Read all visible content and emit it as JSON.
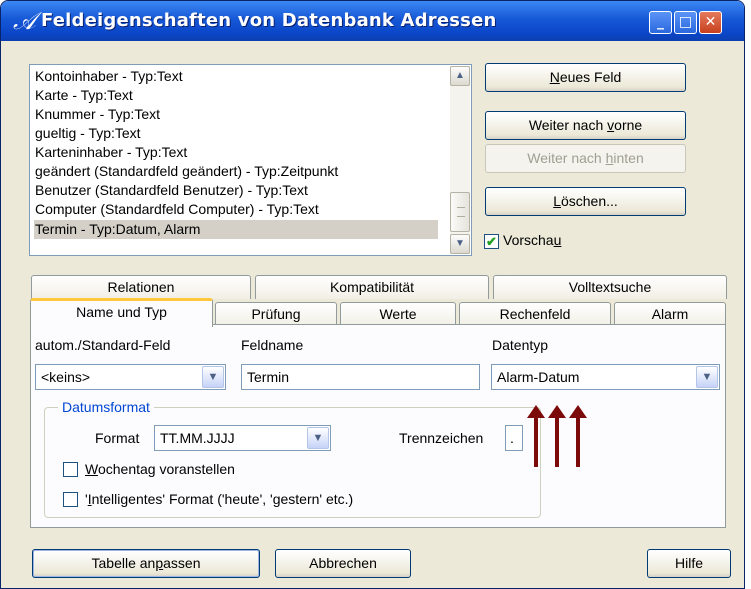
{
  "window": {
    "title": "Feldeigenschaften von Datenbank Adressen",
    "title_icon": "script-a-icon",
    "controls": [
      "minimize-icon",
      "maximize-icon",
      "close-icon"
    ]
  },
  "fields_list": {
    "items": [
      "Kontoinhaber - Typ:Text",
      "Karte - Typ:Text",
      "Knummer - Typ:Text",
      "gueltig - Typ:Text",
      "Karteninhaber - Typ:Text",
      "geändert (Standardfeld geändert) - Typ:Zeitpunkt",
      "Benutzer (Standardfeld Benutzer) - Typ:Text",
      "Computer (Standardfeld Computer) - Typ:Text",
      "Termin - Typ:Datum, Alarm"
    ],
    "selected_index": 8
  },
  "buttons": {
    "neues_feld": {
      "pre": "",
      "acc": "N",
      "post": "eues Feld"
    },
    "weiter_vorne": {
      "pre": "Weiter nach ",
      "acc": "v",
      "post": "orne"
    },
    "weiter_hinten": {
      "pre": "Weiter nach ",
      "acc": "h",
      "post": "inten"
    },
    "loeschen": {
      "pre": "",
      "acc": "L",
      "post": "öschen..."
    },
    "tabelle": {
      "pre": "Tabelle an",
      "acc": "p",
      "post": "assen"
    },
    "abbrechen": "Abbrechen",
    "hilfe": "Hilfe"
  },
  "vorschau": {
    "pre": "Vorscha",
    "acc": "u",
    "post": "",
    "checked": true
  },
  "tabs_back": [
    "Relationen",
    "Kompatibilität",
    "Volltextsuche"
  ],
  "tabs_front": [
    "Name und Typ",
    "Prüfung",
    "Werte",
    "Rechenfeld",
    "Alarm"
  ],
  "active_tab": "Name und Typ",
  "panel": {
    "autom_label": "autom./Standard-Feld",
    "autom_value": "<keins>",
    "feldname_label": "Feldname",
    "feldname_value": "Termin",
    "datentyp_label": "Datentyp",
    "datentyp_value": "Alarm-Datum",
    "group_title": "Datumsformat",
    "format_label": "Format",
    "format_value": "TT.MM.JJJJ",
    "trenn_label": "Trennzeichen",
    "trenn_value": ".",
    "wochentag": {
      "acc": "W",
      "post": "ochentag voranstellen",
      "checked": false
    },
    "intelligent": {
      "pre": "'",
      "acc": "I",
      "post": "ntelligentes' Format ('heute', 'gestern' etc.)",
      "checked": false
    }
  },
  "colors": {
    "annotation_arrows": "#7c0a0a",
    "group_title": "#0046d5",
    "active_tab_accent": "#ffc73c"
  },
  "annotation_arrows": 3
}
